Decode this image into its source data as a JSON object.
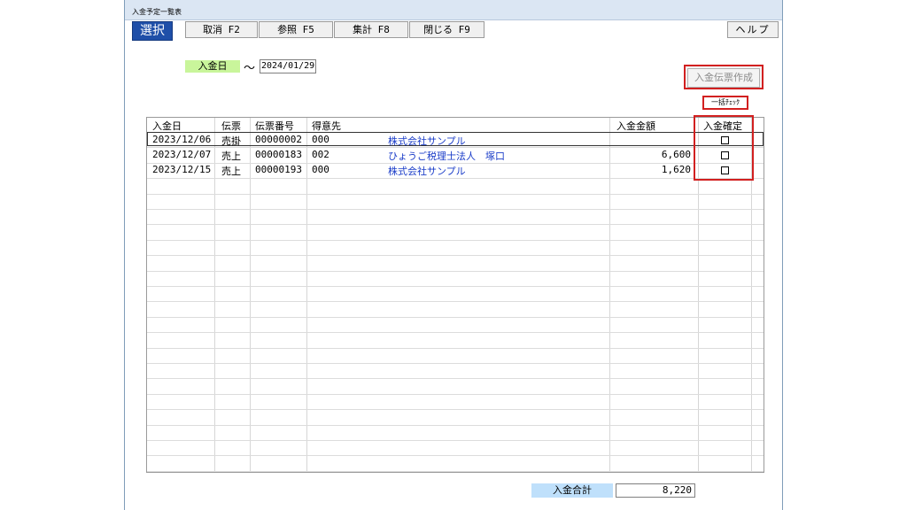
{
  "window": {
    "title": "入金予定一覧表"
  },
  "toolbar": {
    "mode": "選択",
    "buttons": [
      "取消 F2",
      "参照 F5",
      "集計 F8",
      "閉じる F9"
    ],
    "help": "ヘルプ"
  },
  "filter": {
    "date_label": "入金日",
    "tilde": "～",
    "date_value": "2024/01/29"
  },
  "actions": {
    "create_slip": "入金伝票作成",
    "bulk_check": "一括ﾁｪｯｸ"
  },
  "table": {
    "headers": [
      "入金日",
      "伝票",
      "伝票番号",
      "得意先",
      "入金金額",
      "入金確定"
    ],
    "rows": [
      {
        "date": "2023/12/06",
        "type": "売掛",
        "slip_no": "00000002",
        "code": "000",
        "customer": "株式会社サンプル",
        "amount": "",
        "confirmed": false
      },
      {
        "date": "2023/12/07",
        "type": "売上",
        "slip_no": "00000183",
        "code": "002",
        "customer": "ひょうご税理士法人　塚口",
        "amount": "6,600",
        "confirmed": false
      },
      {
        "date": "2023/12/15",
        "type": "売上",
        "slip_no": "00000193",
        "code": "000",
        "customer": "株式会社サンプル",
        "amount": "1,620",
        "confirmed": false
      }
    ]
  },
  "footer": {
    "total_label": "入金合計",
    "total_value": "8,220"
  },
  "colors": {
    "mode_bg": "#1f4fa8",
    "highlight_red": "#d22020",
    "date_label_bg": "#c9f59b",
    "total_label_bg": "#bfe0fb",
    "customer_text": "#1a3cc8"
  }
}
